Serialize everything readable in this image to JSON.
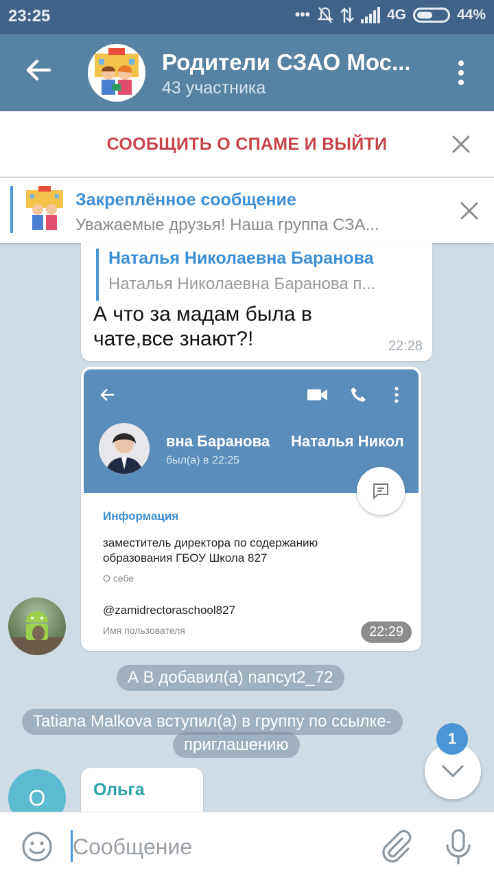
{
  "status_bar": {
    "time": "23:25",
    "network": "4G",
    "battery": "44%"
  },
  "header": {
    "title": "Родители СЗАО Мос...",
    "subtitle": "43 участника"
  },
  "spam_bar": {
    "label": "СООБЩИТЬ О СПАМЕ И ВЫЙТИ"
  },
  "pinned": {
    "title": "Закреплённое сообщение",
    "preview": "Уважаемые друзья! Наша группа СЗА..."
  },
  "messages": [
    {
      "reply_name": "Наталья Николаевна Баранова",
      "reply_text": "Наталья Николаевна Баранова п...",
      "text": "А что за мадам была в чате,все знают?!",
      "time": "22:28"
    },
    {
      "time": "22:29",
      "screenshot": {
        "name_part1": "вна Баранова",
        "name_part2": "Наталья Никол",
        "seen": "был(а) в 22:25",
        "info_title": "Информация",
        "bio": "заместитель директора по содержанию образования ГБОУ Школа 827",
        "bio_label": "О себе",
        "username": "@zamidrectoraschool827",
        "username_label": "Имя пользователя"
      }
    },
    {
      "sender": "Ольга",
      "avatar_letter": "О"
    }
  ],
  "service": [
    "А В добавил(а) nancyt2_72",
    "Tatiana Malkova вступил(а) в группу по ссылке-",
    "приглашению"
  ],
  "unread_count": "1",
  "input": {
    "placeholder": "Сообщение"
  }
}
